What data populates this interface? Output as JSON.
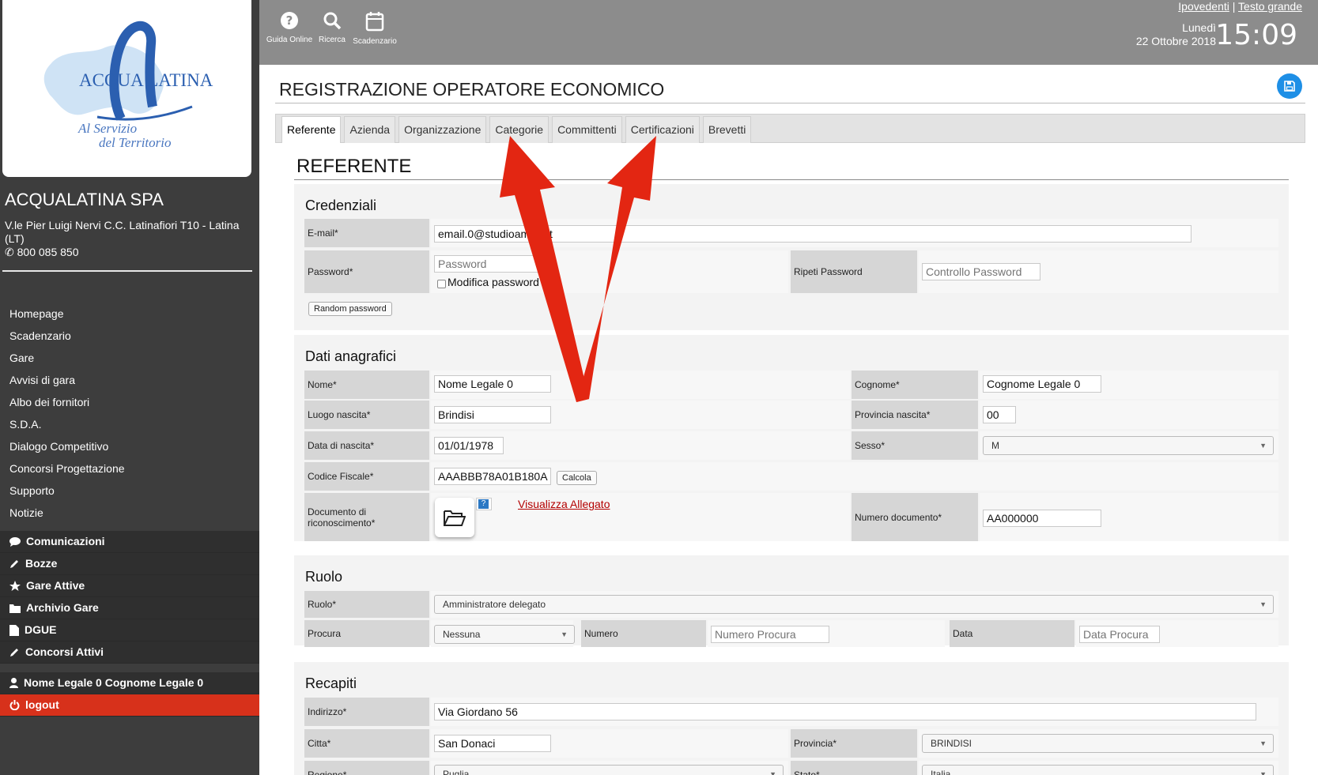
{
  "sidebar": {
    "logo_text": "ACQUA LATINA",
    "logo_slogan_1": "Al Servizio",
    "logo_slogan_2": "del Territorio",
    "company_name": "ACQUALATINA SPA",
    "address": "V.le Pier Luigi Nervi C.C. Latinafiori T10 - Latina (LT)",
    "phone": "800 085 850",
    "nav": [
      "Homepage",
      "Scadenzario",
      "Gare",
      "Avvisi di gara",
      "Albo dei fornitori",
      "S.D.A.",
      "Dialogo Competitivo",
      "Concorsi Progettazione",
      "Supporto",
      "Notizie"
    ],
    "sections": [
      {
        "label": "Comunicazioni",
        "icon": "comment-icon"
      },
      {
        "label": "Bozze",
        "icon": "pencil-icon"
      },
      {
        "label": "Gare Attive",
        "icon": "star-icon"
      },
      {
        "label": "Archivio Gare",
        "icon": "folder-icon"
      },
      {
        "label": "DGUE",
        "icon": "document-icon"
      },
      {
        "label": "Concorsi Attivi",
        "icon": "pencil-icon"
      }
    ],
    "user": "Nome Legale 0 Cognome Legale 0",
    "logout": "logout"
  },
  "topbar": {
    "tools": [
      {
        "label": "Guida Online",
        "icon": "help-icon"
      },
      {
        "label": "Ricerca",
        "icon": "search-icon"
      },
      {
        "label": "Scadenzario",
        "icon": "calendar-icon"
      }
    ],
    "link_ipovedenti": "Ipovedenti",
    "separator": "|",
    "link_testo_grande": "Testo grande",
    "day": "Lunedì",
    "date": "22 Ottobre 2018",
    "time": "15:09"
  },
  "page": {
    "title": "REGISTRAZIONE OPERATORE ECONOMICO",
    "tabs": [
      "Referente",
      "Azienda",
      "Organizzazione",
      "Categorie",
      "Committenti",
      "Certificazioni",
      "Brevetti"
    ],
    "active_tab": "Referente",
    "section_title": "REFERENTE"
  },
  "credenziali": {
    "title": "Credenziali",
    "email_label": "E-mail*",
    "email_value": "email.0@studioamica.it",
    "password_label": "Password*",
    "password_placeholder": "Password",
    "modifica_password": "Modifica password",
    "ripeti_label": "Ripeti Password",
    "controllo_placeholder": "Controllo Password",
    "random_btn": "Random password"
  },
  "anagrafici": {
    "title": "Dati anagrafici",
    "nome_label": "Nome*",
    "nome_value": "Nome Legale 0",
    "cognome_label": "Cognome*",
    "cognome_value": "Cognome Legale 0",
    "luogo_label": "Luogo nascita*",
    "luogo_value": "Brindisi",
    "provincia_label": "Provincia nascita*",
    "provincia_value": "00",
    "data_label": "Data di nascita*",
    "data_value": "01/01/1978",
    "sesso_label": "Sesso*",
    "sesso_value": "M",
    "cf_label": "Codice Fiscale*",
    "cf_value": "AAABBB78A01B180A",
    "calcola_btn": "Calcola",
    "doc_label": "Documento di riconoscimento*",
    "visualizza": "Visualizza Allegato",
    "numdoc_label": "Numero documento*",
    "numdoc_value": "AA000000"
  },
  "ruolo": {
    "title": "Ruolo",
    "ruolo_label": "Ruolo*",
    "ruolo_value": "Amministratore delegato",
    "procura_label": "Procura",
    "procura_value": "Nessuna",
    "numero_label": "Numero",
    "numero_placeholder": "Numero Procura",
    "data_label": "Data",
    "data_placeholder": "Data Procura"
  },
  "recapiti": {
    "title": "Recapiti",
    "indirizzo_label": "Indirizzo*",
    "indirizzo_value": "Via Giordano 56",
    "citta_label": "Citta*",
    "citta_value": "San Donaci",
    "provincia_label": "Provincia*",
    "provincia_value": "BRINDISI",
    "regione_label": "Regione*",
    "regione_value": "Puglia",
    "stato_label": "Stato*",
    "stato_value": "Italia"
  },
  "colors": {
    "sidebar": "#3d3d3d",
    "topbar": "#8c8c8c",
    "logout": "#d7311b",
    "accent": "#1e8fe6",
    "arrow": "#e32612"
  }
}
